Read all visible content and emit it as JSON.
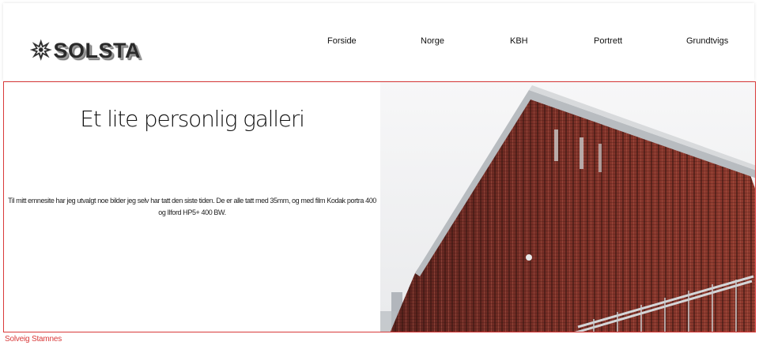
{
  "brand": {
    "name": "SOLSTA"
  },
  "nav": {
    "items": [
      {
        "label": "Forside"
      },
      {
        "label": "Norge"
      },
      {
        "label": "KBH"
      },
      {
        "label": "Portrett"
      },
      {
        "label": "Grundtvigs"
      }
    ]
  },
  "hero": {
    "title": "Et lite personlig galleri",
    "text": "Til mitt emnesite har jeg utvalgt noe bilder jeg selv har tatt den siste tiden. De er alle tatt med 35mm, og med film Kodak portra 400 og Ilford HP5+ 400 BW."
  },
  "footer": {
    "credit": "Solveig Stamnes"
  },
  "colors": {
    "accent": "#d93a3a",
    "building": "#7a2f26"
  }
}
